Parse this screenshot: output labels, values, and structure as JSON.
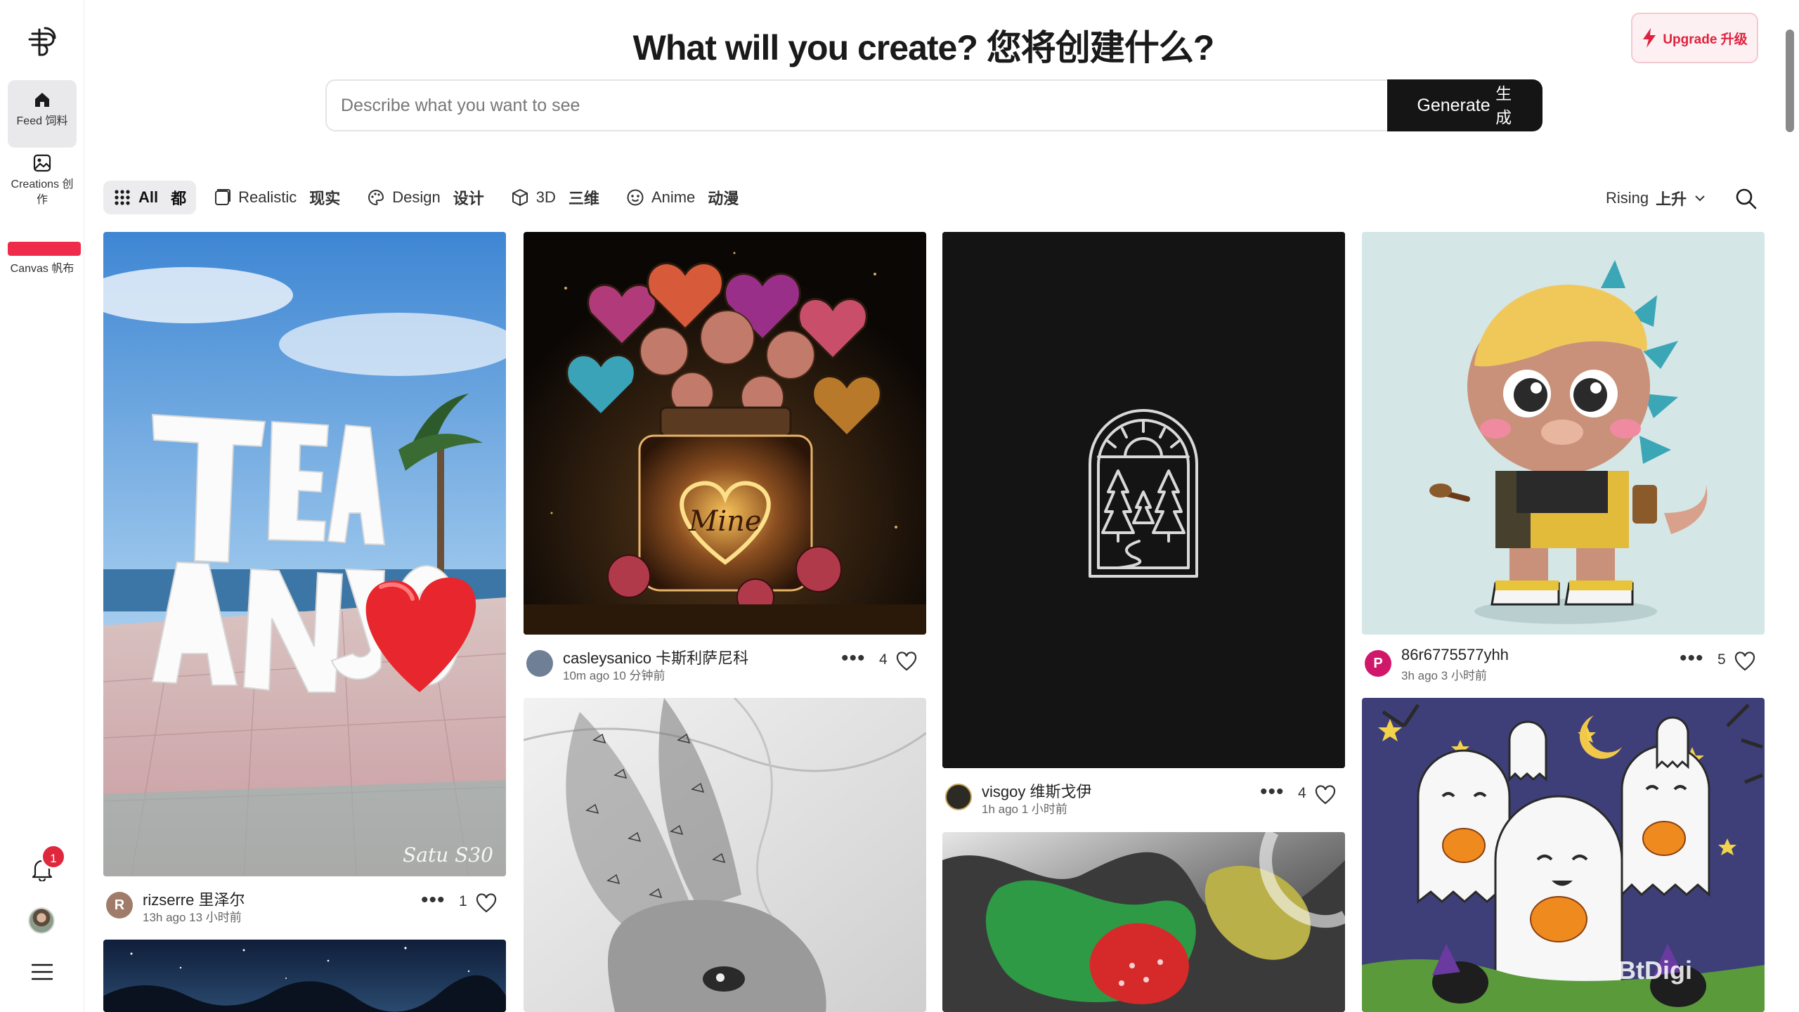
{
  "sidebar": {
    "items": [
      {
        "label": "Feed 饲料",
        "icon": "home-icon"
      },
      {
        "label": "Creations 创作",
        "icon": "image-icon"
      },
      {
        "label": "Canvas 帆布",
        "icon": "canvas-icon"
      }
    ],
    "notification_count": "1"
  },
  "header": {
    "title": "What will you create? 您将创建什么?",
    "upgrade_label": "Upgrade",
    "upgrade_label_zh": "升级"
  },
  "search": {
    "placeholder": "Describe what you want to see",
    "generate_label": "Generate",
    "generate_label_zh": "生成"
  },
  "filters": [
    {
      "label": "All",
      "label_zh": "都",
      "icon": "grid-icon",
      "active": true
    },
    {
      "label": "Realistic",
      "label_zh": "现实",
      "icon": "photo-icon",
      "active": false
    },
    {
      "label": "Design",
      "label_zh": "设计",
      "icon": "palette-icon",
      "active": false
    },
    {
      "label": "3D",
      "label_zh": "三维",
      "icon": "cube-icon",
      "active": false
    },
    {
      "label": "Anime",
      "label_zh": "动漫",
      "icon": "anime-face-icon",
      "active": false
    }
  ],
  "sort": {
    "label": "Rising",
    "label_zh": "上升"
  },
  "cards": [
    {
      "user": "rizserre 里泽尔",
      "time": "13h ago 13 小时前",
      "likes": "1",
      "avatar_letter": "R",
      "avatar_color": "#a07b6a",
      "image_text": "Satu S30"
    },
    {
      "user": "casleysanico 卡斯利萨尼科",
      "time": "10m ago 10 分钟前",
      "likes": "4",
      "avatar_letter": "",
      "avatar_color": "#6f7f96"
    },
    {
      "user": "visgoy 维斯戈伊",
      "time": "1h ago 1 小时前",
      "likes": "4",
      "avatar_letter": "",
      "avatar_color": "#2c2a24"
    },
    {
      "user": "86r6775577yhh",
      "time": "3h ago 3 小时前",
      "likes": "5",
      "avatar_letter": "P",
      "avatar_color": "#d0176a"
    }
  ],
  "watermark": "BtDigi"
}
